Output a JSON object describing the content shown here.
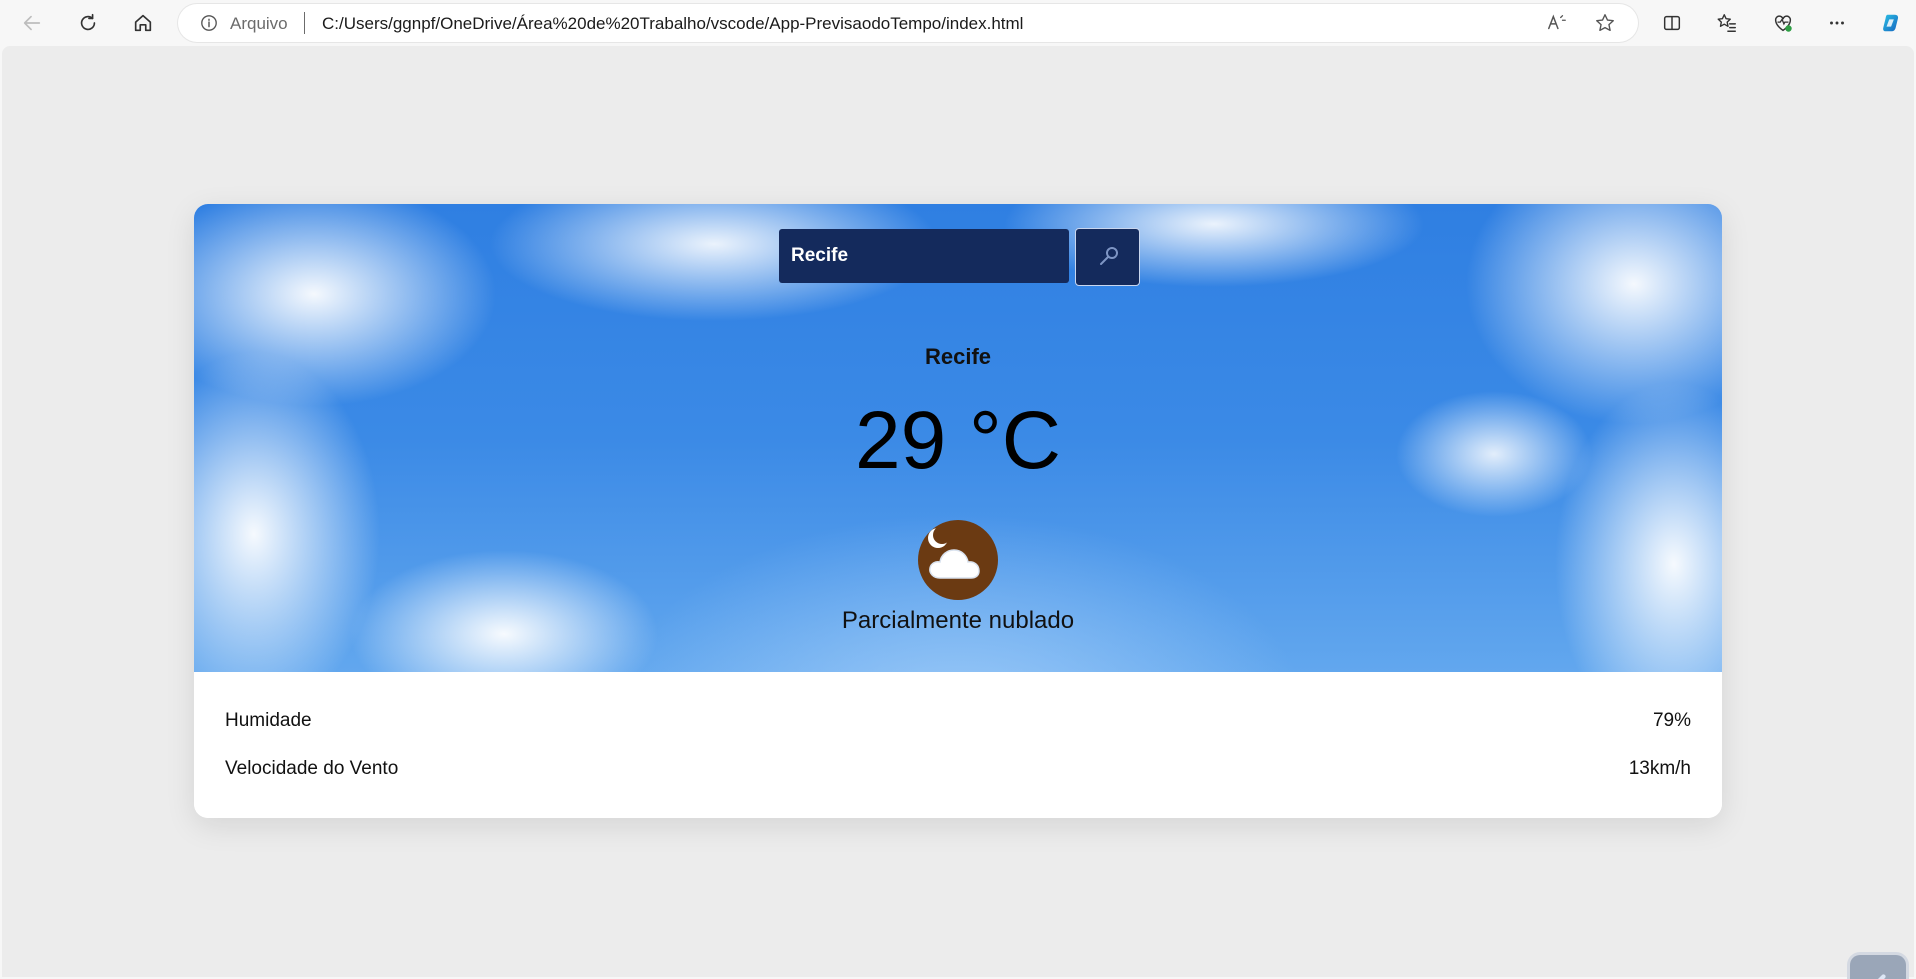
{
  "browser": {
    "address_scheme": "Arquivo",
    "address_url": "C:/Users/ggnpf/OneDrive/Área%20de%20Trabalho/vscode/App-PrevisaodoTempo/index.html"
  },
  "weather": {
    "search": {
      "value": "Recife"
    },
    "city": "Recife",
    "temperature": "29 °C",
    "icon": "partly-cloudy-night-icon",
    "description": "Parcialmente nublado",
    "details": [
      {
        "label": "Humidade",
        "value": "79%"
      },
      {
        "label": "Velocidade do Vento",
        "value": "13km/h"
      }
    ]
  },
  "colors": {
    "search_bg": "#142a5c",
    "sky": "#2f7fe2",
    "icon_bg": "#6b3a12"
  }
}
